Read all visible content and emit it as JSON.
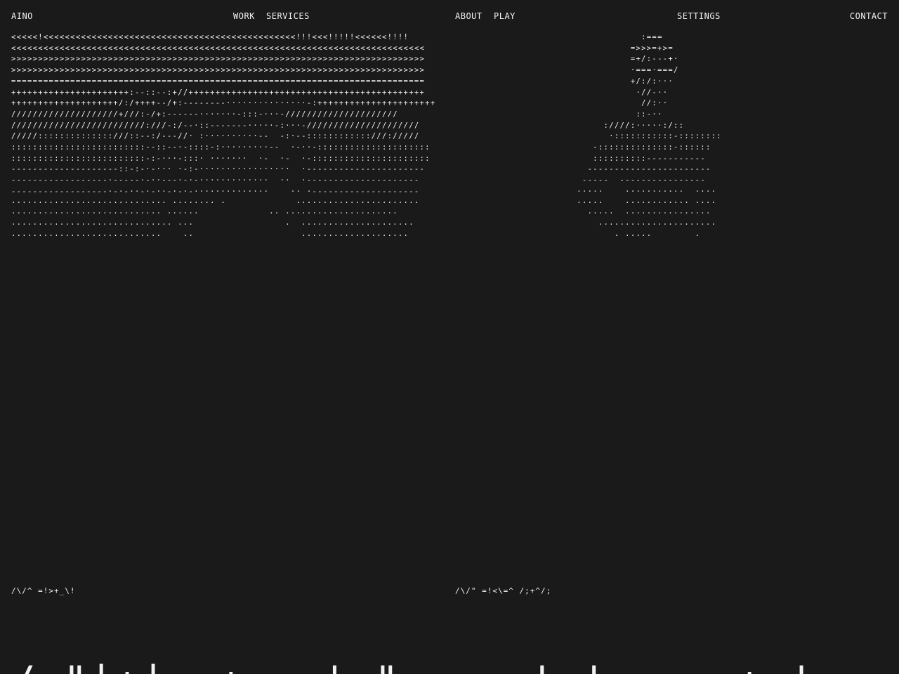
{
  "nav": {
    "brand": "AINO",
    "work": "WORK",
    "services": "SERVICES",
    "about": "ABOUT",
    "play": "PLAY",
    "settings": "SETTINGS",
    "contact": "CONTACT"
  },
  "art": {
    "left": "<<<<<!<<<<<<<<<<<<<<<<<<<<<<<<<<<<<<<<<<<<<<<<<<<<<<<!!!<<<!!!!!<<<<<<!!!!\n<<<<<<<<<<<<<<<<<<<<<<<<<<<<<<<<<<<<<<<<<<<<<<<<<<<<<<<<<<<<<<<<<<<<<<<<<<<<<\n>>>>>>>>>>>>>>>>>>>>>>>>>>>>>>>>>>>>>>>>>>>>>>>>>>>>>>>>>>>>>>>>>>>>>>>>>>>>>\n>>>>>>>>>>>>>>>>>>>>>>>>>>>>>>>>>>>>>>>>>>>>>>>>>>>>>>>>>>>>>>>>>>>>>>>>>>>>>\n=============================================================================\n++++++++++++++++++++++:--::--:+//++++++++++++++++++++++++++++++++++++++++++++\n++++++++++++++++++++/:/++++--/+:--------···············-:++++++++++++++++++++++\n////////////////////+///:-/+:------·······-:::-···-/////////////////////\n/////////////////////////:///-:/--·::-------·····-:···-/////////////////////\n/////::::::::::::::///::--:/---//· :··········--  -:·--::::::::::::///://///\n:::::::::::::::::::::::::--::--·-::::-:·········--  ·-··-:::::::::::::::::::::\n:::::::::::::::::::::::::-:-···-:::· ·······  ·-  ·-  ·-::::::::::::::::::::::\n--------------------::-:-·-··· ·-:-·················  ·----------------------\n------------------·-----·-··---·-·-·············  ··  ·---------------------\n------------------·-·-··-·-··-·-·-··············    ·· ·--------------------\n····························· ········ ·             ·······················\n···························· ······             ·· ·····················\n······························ ···                 ·  ·····················\n····························    ··                    ····················",
    "right": "              :===\n            =>>>=+>=\n            =+/:---+·\n            ·===·===/\n            +/:/:···\n             ·//-··\n              //:··\n             ::-··\n       :////:·····:/::\n        ·:::::::::::-::::::::\n     -::::::::::::::-::::::\n     ::::::::::-----------\n    -----------------------\n   -----  ----------------\n  ·····    ···········  ····\n  ·····    ············ ····\n    ·····  ················\n      ······················\n         · ·····        ·"
  },
  "captions": {
    "left": "/\\/^ =!>+_\\!",
    "right": "/\\/\" =!<\\=^ /;+^/;"
  },
  "heading": "/=\"|+|=_+ _ ' \" _ _ ' ' _ _ + '"
}
